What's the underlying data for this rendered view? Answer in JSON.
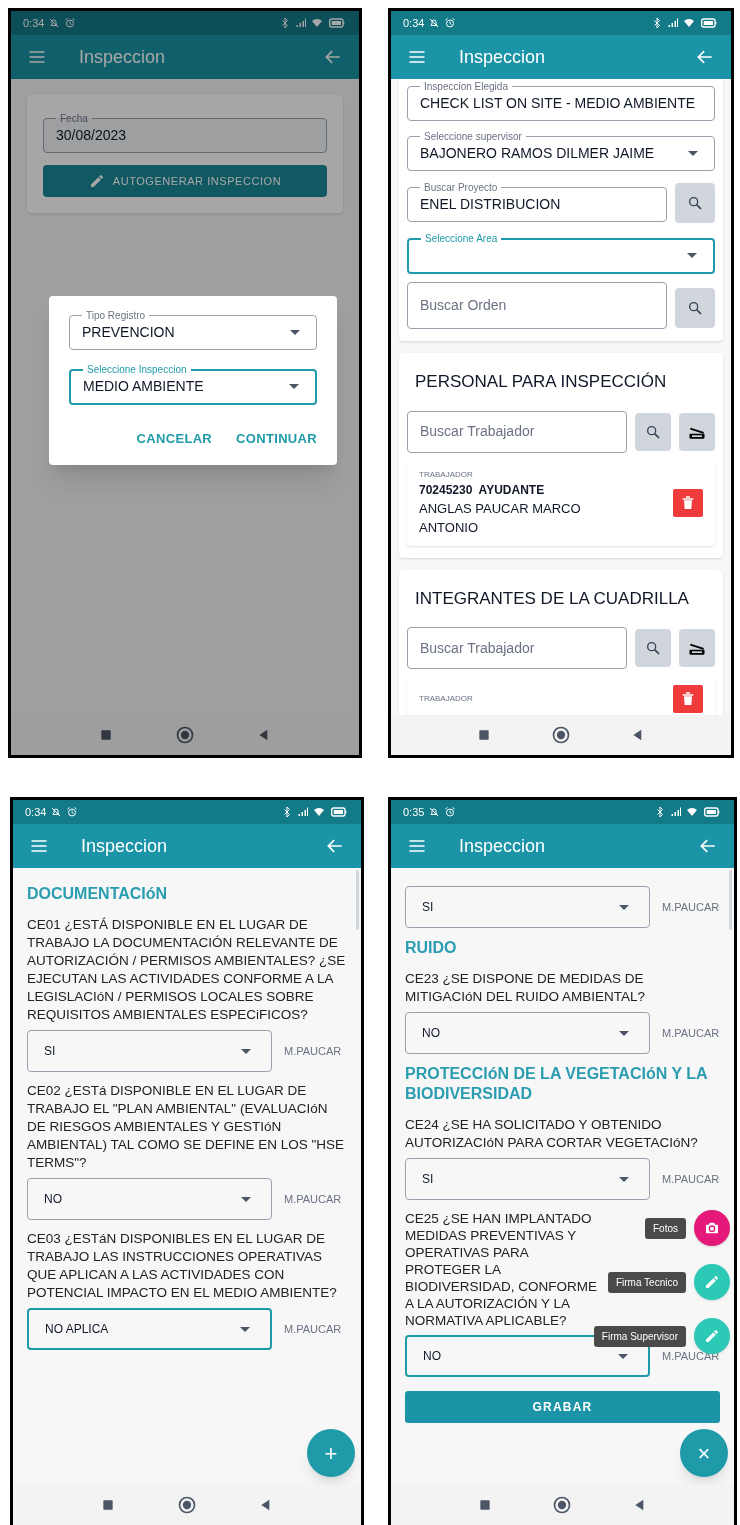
{
  "screens": [
    {
      "kind": "dialog",
      "status_time": "0:34",
      "title": "Inspeccion",
      "date_field": {
        "label": "Fecha",
        "value": "30/08/2023"
      },
      "autogen_button": "AUTOGENERAR INSPECCION",
      "dialog": {
        "fields": [
          {
            "kind": "select",
            "label": "Tipo Registro",
            "value": "PREVENCION",
            "focused": false
          },
          {
            "kind": "select",
            "label": "Seleccione Inspeccion",
            "value": "MEDIO AMBIENTE",
            "focused": true
          }
        ],
        "buttons": [
          "CANCELAR",
          "CONTINUAR"
        ]
      }
    },
    {
      "kind": "form",
      "status_time": "0:34",
      "title": "Inspeccion",
      "fields": [
        {
          "kind": "text",
          "label": "Inspeccion Elegida",
          "value": "CHECK LIST ON SITE - MEDIO AMBIENTE",
          "focused": false
        },
        {
          "kind": "select",
          "label": "Seleccione supervisor",
          "value": "BAJONERO RAMOS DILMER JAIME",
          "focused": false
        },
        {
          "kind": "search",
          "label": "Buscar Proyecto",
          "value": "ENEL DISTRIBUCION",
          "focused": false
        },
        {
          "kind": "select",
          "label": "Seleccione Area",
          "focused": true
        },
        {
          "kind": "search",
          "placeholder": "Buscar Orden",
          "focused": false
        }
      ],
      "sections": [
        {
          "title": "PERSONAL PARA INSPECCIÓN",
          "search_placeholder": "Buscar Trabajador",
          "workers": [
            {
              "caption": "TRABAJADOR",
              "line1": "70245230  AYUDANTE",
              "line2": "ANGLAS PAUCAR MARCO ANTONIO"
            }
          ]
        },
        {
          "title": "INTEGRANTES DE LA CUADRILLA",
          "search_placeholder": "Buscar Trabajador",
          "workers": [
            {
              "caption": "TRABAJADOR"
            }
          ]
        }
      ]
    },
    {
      "kind": "checklist",
      "status_time": "0:34",
      "title": "Inspeccion",
      "items": [
        {
          "kind": "heading",
          "text": "DOCUMENTACIóN"
        },
        {
          "kind": "question",
          "text": "CE01 ¿ESTÁ DISPONIBLE EN EL LUGAR DE TRABAJO LA DOCUMENTACIÓN RELEVANTE DE AUTORIZACIÓN / PERMISOS AMBIENTALES? ¿SE EJECUTAN LAS ACTIVIDADES CONFORME A LA LEGISLACIóN / PERMISOS LOCALES SOBRE REQUISITOS AMBIENTALES ESPECiFICOS?",
          "answer": "SI",
          "focused": false,
          "inspector": "M.PAUCAR"
        },
        {
          "kind": "question",
          "text": "CE02 ¿ESTá DISPONIBLE EN EL LUGAR DE TRABAJO EL \"PLAN AMBIENTAL\" (EVALUACIóN DE RIESGOS AMBIENTALES Y GESTIóN AMBIENTAL) TAL COMO SE DEFINE EN LOS \"HSE TERMS\"?",
          "answer": "NO",
          "focused": false,
          "inspector": "M.PAUCAR"
        },
        {
          "kind": "question",
          "text": "CE03 ¿ESTáN DISPONIBLES EN EL LUGAR DE TRABAJO LAS INSTRUCCIONES OPERATIVAS QUE APLICAN A LAS ACTIVIDADES CON POTENCIAL IMPACTO EN EL MEDIO AMBIENTE?",
          "answer": "NO APLICA",
          "focused": true,
          "inspector": "M.PAUCAR"
        }
      ],
      "fab": "+"
    },
    {
      "kind": "checklist",
      "status_time": "0:35",
      "title": "Inspeccion",
      "items": [
        {
          "kind": "answer",
          "answer": "SI",
          "focused": false,
          "inspector": "M.PAUCAR"
        },
        {
          "kind": "heading",
          "text": "RUIDO"
        },
        {
          "kind": "question",
          "text": "CE23 ¿SE DISPONE DE MEDIDAS DE MITIGACIóN DEL RUIDO AMBIENTAL?",
          "answer": "NO",
          "focused": false,
          "inspector": "M.PAUCAR"
        },
        {
          "kind": "heading",
          "text": "PROTECCIóN DE LA VEGETACIóN Y LA BIODIVERSIDAD"
        },
        {
          "kind": "question",
          "text": "CE24 ¿SE HA SOLICITADO Y OBTENIDO AUTORIZACIóN PARA CORTAR VEGETACIóN?",
          "answer": "SI",
          "focused": false,
          "inspector": "M.PAUCAR"
        },
        {
          "kind": "question",
          "text": "CE25 ¿SE HAN IMPLANTADO MEDIDAS PREVENTIVAS Y OPERATIVAS PARA PROTEGER LA BIODIVERSIDAD, CONFORME A LA AUTORIZACIÓN Y LA NORMATIVA APLICABLE?",
          "answer": "NO",
          "focused": true,
          "inspector": "M.PAUCAR"
        }
      ],
      "save_button": "GRABAR",
      "fab_menu": [
        {
          "label": "Fotos",
          "kind": "photo",
          "color": "#e5197a"
        },
        {
          "label": "Firma Tecnico",
          "kind": "signature",
          "color": "#2cc9b7"
        },
        {
          "label": "Firma Supervisor",
          "kind": "signature",
          "color": "#2cc9b7"
        }
      ],
      "fab": "×"
    }
  ]
}
